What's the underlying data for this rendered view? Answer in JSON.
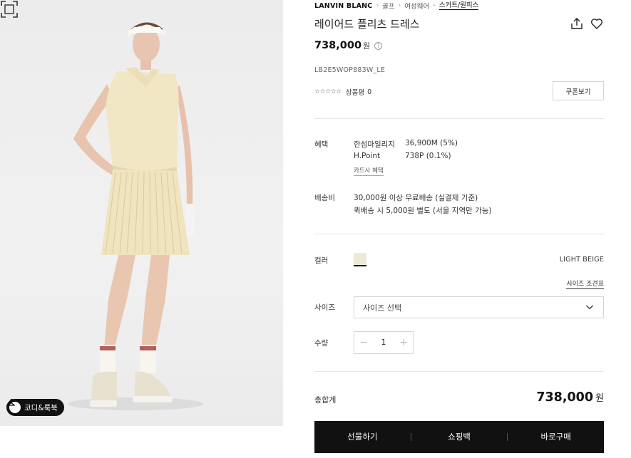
{
  "product_image": {
    "alt": "모델 착용 이미지",
    "coordi_label": "코디&룩북",
    "zoom_icon": "fullscreen-icon"
  },
  "breadcrumb": [
    "LANVIN BLANC",
    "골프",
    "여성웨어",
    "스커트/원피스"
  ],
  "title": "레이어드 플리츠 드레스",
  "price": {
    "value": "738,000",
    "unit": "원",
    "help": "?"
  },
  "product_code": "LB2E5WOP883W_LE",
  "rating": {
    "stars": "☆☆☆☆☆",
    "review_label": "상품평",
    "review_count": "0"
  },
  "coupon_label": "쿠폰보기",
  "benefits": {
    "label": "혜택",
    "items": [
      {
        "name": "한섬마일리지",
        "value": "36,900M (5%)"
      },
      {
        "name": "H.Point",
        "value": "738P (0.1%)"
      }
    ],
    "card_link": "카드사 혜택"
  },
  "shipping": {
    "label": "배송비",
    "line1": "30,000원 이상 무료배송 (실결제 기준)",
    "line2": "퀵배송 시 5,000원 별도 (서울 지역만 가능)"
  },
  "color": {
    "label": "컬러",
    "name": "LIGHT BEIGE",
    "swatch": "#efe9d8"
  },
  "size": {
    "label": "사이즈",
    "guide_link": "사이즈 조견표",
    "placeholder": "사이즈 선택"
  },
  "quantity": {
    "label": "수량",
    "minus": "−",
    "value": "1",
    "plus": "+"
  },
  "total": {
    "label": "총합계",
    "value": "738,000",
    "unit": "원"
  },
  "actions": {
    "gift": "선물하기",
    "cart": "쇼핑백",
    "buy": "바로구매"
  }
}
